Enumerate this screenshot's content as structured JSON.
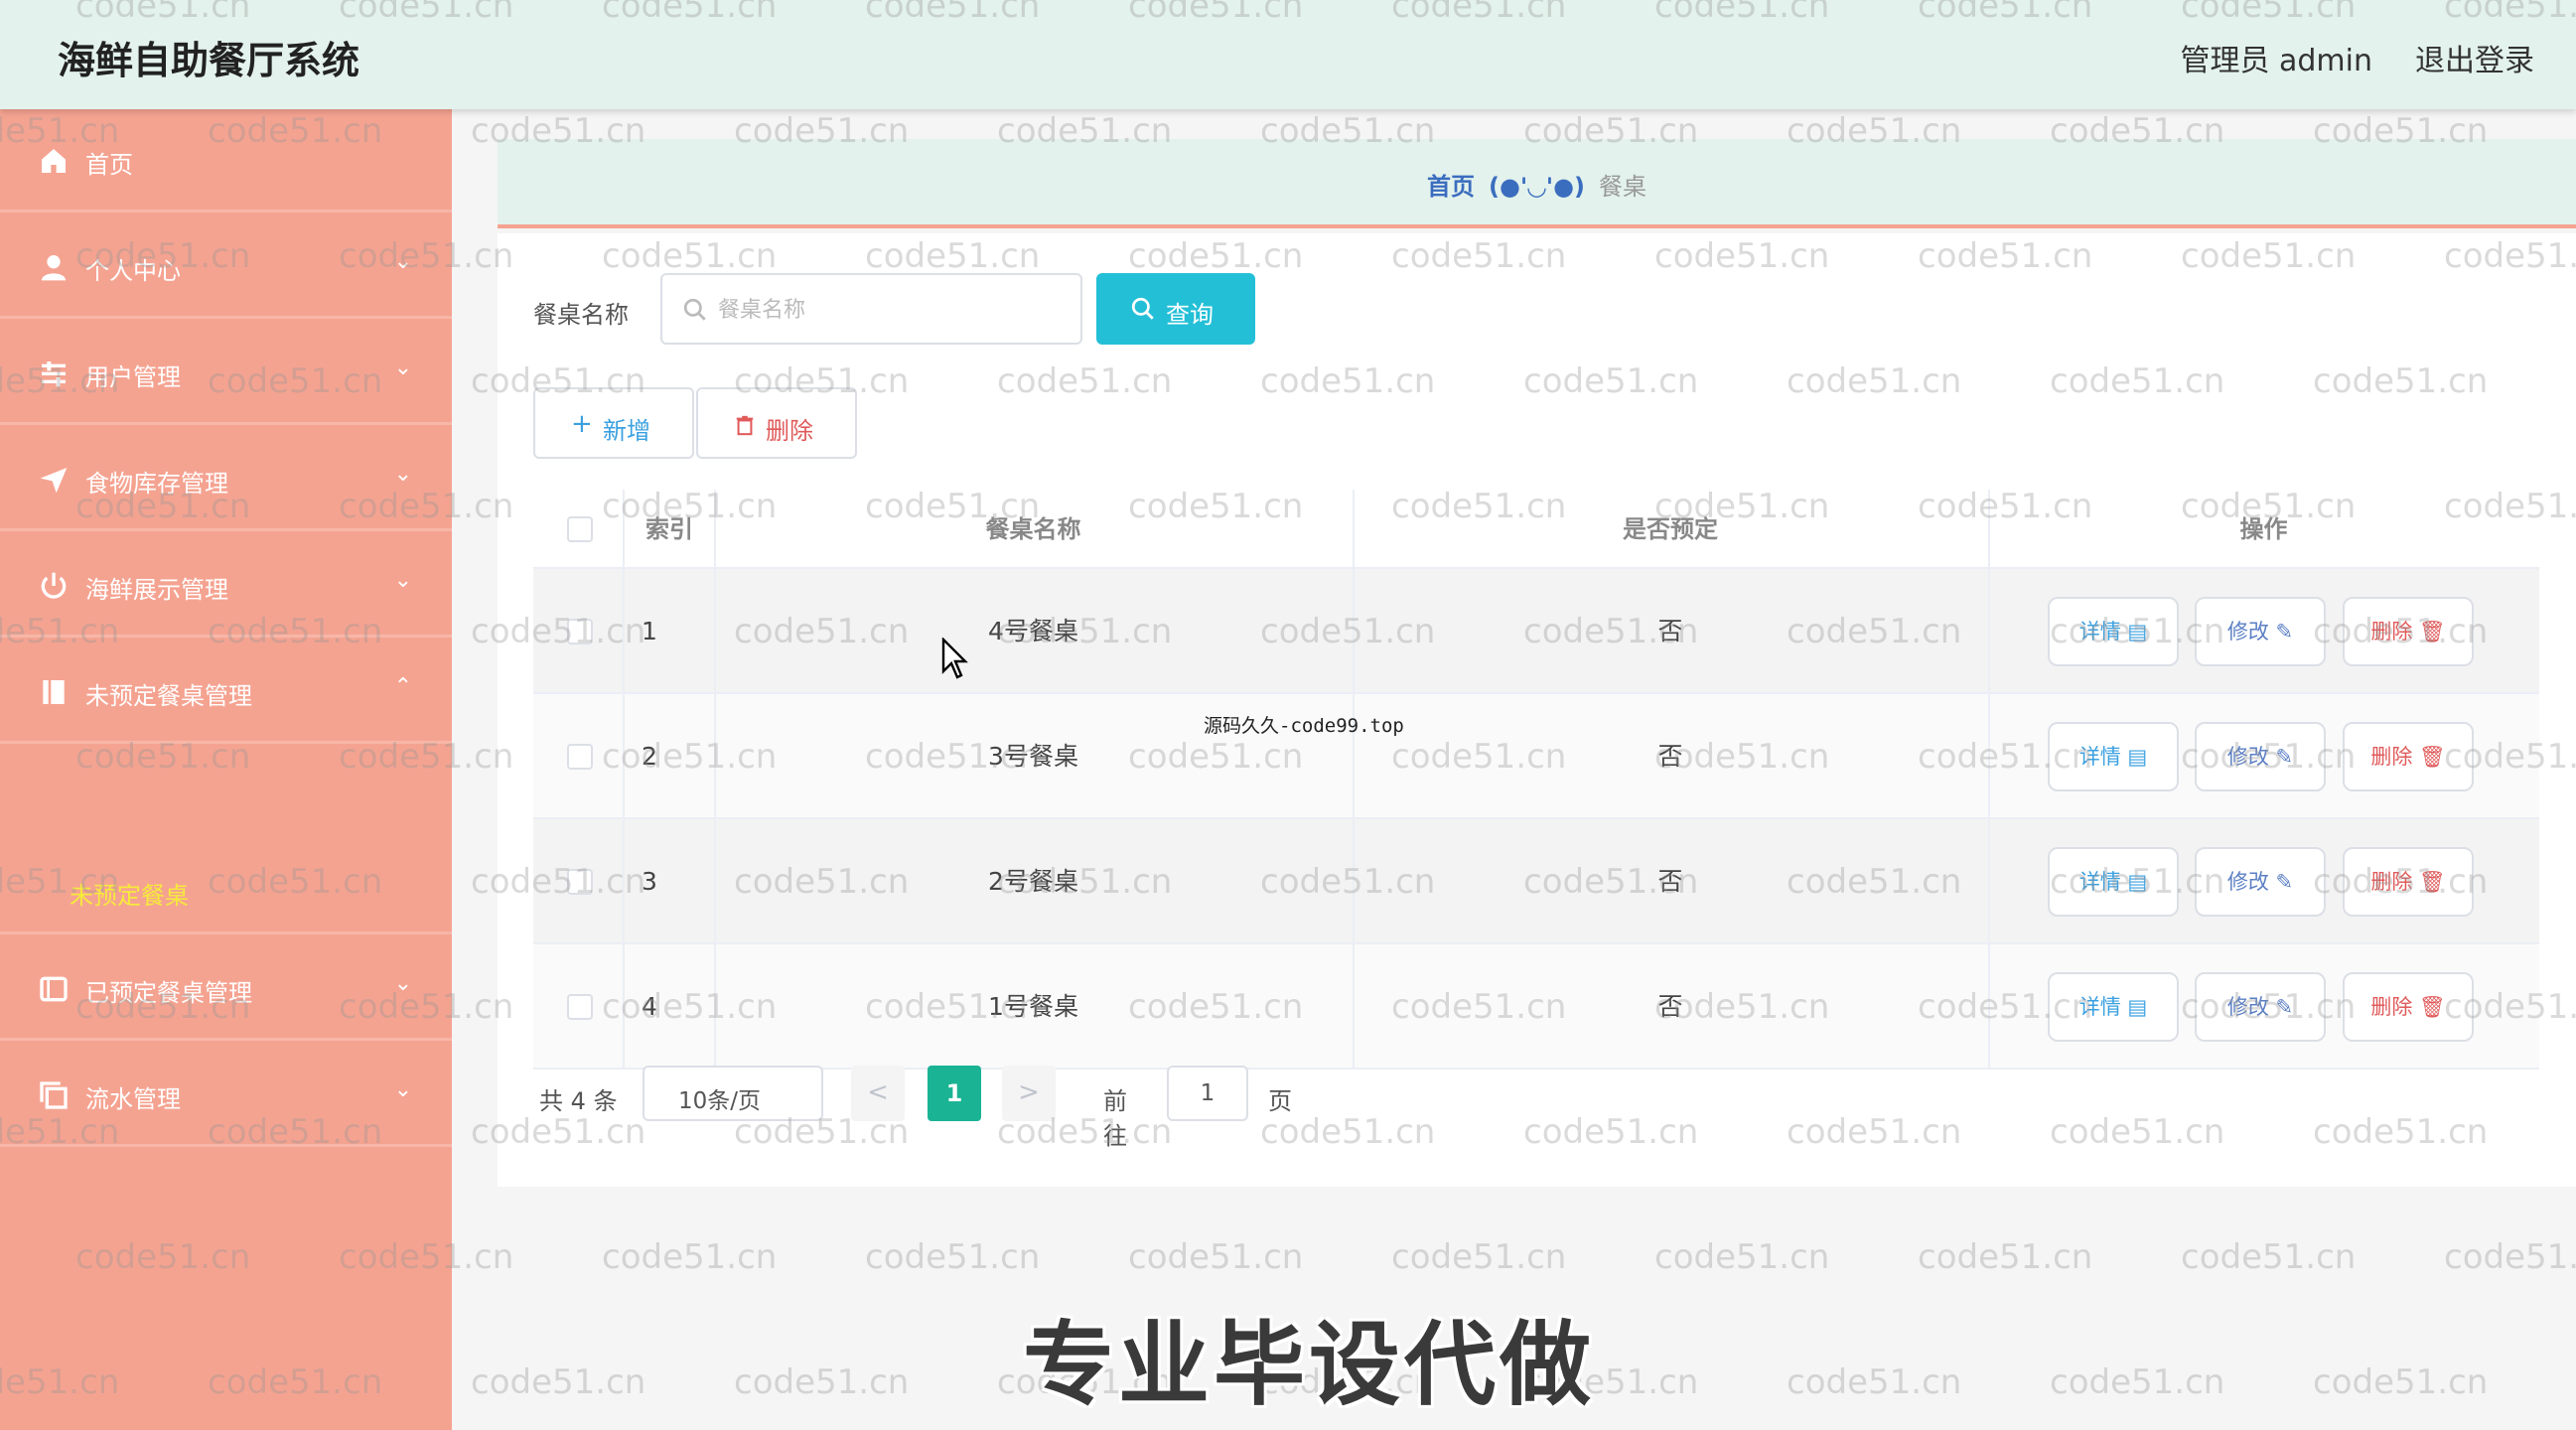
{
  "header": {
    "app_title": "海鲜自助餐厅系统",
    "admin_label": "管理员 admin",
    "logout_label": "退出登录"
  },
  "sidebar": {
    "items": [
      {
        "label": "首页",
        "icon": "home-icon"
      },
      {
        "label": "个人中心",
        "icon": "user-icon"
      },
      {
        "label": "用户管理",
        "icon": "sliders-icon"
      },
      {
        "label": "食物库存管理",
        "icon": "send-icon"
      },
      {
        "label": "海鲜展示管理",
        "icon": "power-icon"
      },
      {
        "label": "未预定餐桌管理",
        "icon": "book-icon",
        "expanded": true
      },
      {
        "label": "已预定餐桌管理",
        "icon": "tablet-icon"
      },
      {
        "label": "流水管理",
        "icon": "copy-icon"
      }
    ],
    "submenu": {
      "label": "未预定餐桌",
      "active": true
    },
    "chevron_down": "⌄",
    "chevron_up": "⌃"
  },
  "breadcrumb": {
    "home": "首页",
    "separator": "(●'◡'●)",
    "current": "餐桌"
  },
  "search": {
    "label": "餐桌名称",
    "placeholder": "餐桌名称",
    "value": "",
    "query_label": "查询"
  },
  "actions": {
    "add_label": "新增",
    "delete_label": "删除"
  },
  "table": {
    "columns": [
      "索引",
      "餐桌名称",
      "是否预定",
      "操作"
    ],
    "rows": [
      {
        "index": "1",
        "name": "4号餐桌",
        "reserved": "否"
      },
      {
        "index": "2",
        "name": "3号餐桌",
        "reserved": "否"
      },
      {
        "index": "3",
        "name": "2号餐桌",
        "reserved": "否"
      },
      {
        "index": "4",
        "name": "1号餐桌",
        "reserved": "否"
      }
    ],
    "op_detail": "详情 ▤",
    "op_edit": "修改 ✎",
    "op_delete": "删除 🗑"
  },
  "pagination": {
    "total": "共 4 条",
    "page_size": "10条/页",
    "prev": "<",
    "next": ">",
    "current_page": "1",
    "goto_label": "前往",
    "goto_value": "1",
    "page_unit": "页"
  },
  "overlay": {
    "watermark": "code51.cn",
    "source_note": "源码久久-code99.top",
    "caption": "专业毕设代做"
  },
  "colors": {
    "header_bg": "#e3f2ec",
    "sidebar_bg": "#f5a391",
    "accent_cyan": "#23bfd7",
    "pagination_active": "#1ab394",
    "submenu_active": "#f6ea3c"
  }
}
